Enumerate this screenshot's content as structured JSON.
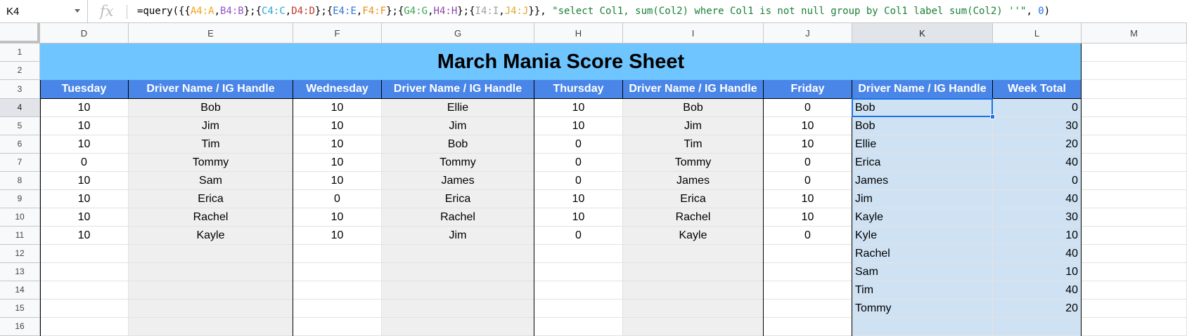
{
  "name_box": "K4",
  "fx_symbol": "fx",
  "formula": {
    "p0": "=query({{",
    "r1": "A4:A",
    "c1": ",",
    "r2": "B4:B",
    "c2": "};{",
    "r3": "C4:C",
    "c3": ",",
    "r4": "D4:D",
    "c4": "};{",
    "r5": "E4:E",
    "c5": ",",
    "r6": "F4:F",
    "c6": "};{",
    "r7": "G4:G",
    "c7": ",",
    "r8": "H4:H",
    "c8": "};{",
    "r9": "I4:I",
    "c9": ",",
    "r10": "J4:J",
    "c10": "}}, ",
    "str": "\"select Col1, sum(Col2) where Col1 is not null group by Col1 label sum(Col2) ''\"",
    "c11": ", ",
    "num": "0",
    "end": ")"
  },
  "columns": [
    "D",
    "E",
    "F",
    "G",
    "H",
    "I",
    "J",
    "K",
    "L",
    "M"
  ],
  "rows": [
    "1",
    "2",
    "3",
    "4",
    "5",
    "6",
    "7",
    "8",
    "9",
    "10",
    "11",
    "12",
    "13",
    "14",
    "15",
    "16"
  ],
  "sheet": {
    "title": "March Mania Score Sheet",
    "headers": [
      "Tuesday",
      "Driver Name / IG Handle",
      "Wednesday",
      "Driver Name / IG Handle",
      "Thursday",
      "Driver Name / IG Handle",
      "Friday",
      "Driver Name / IG Handle",
      "Week Total"
    ],
    "data": [
      [
        "10",
        "Bob",
        "10",
        "Ellie",
        "10",
        "Bob",
        "0",
        "Bob",
        "0"
      ],
      [
        "10",
        "Jim",
        "10",
        "Jim",
        "10",
        "Jim",
        "10",
        "Bob",
        "30"
      ],
      [
        "10",
        "Tim",
        "10",
        "Bob",
        "0",
        "Tim",
        "10",
        "Ellie",
        "20"
      ],
      [
        "0",
        "Tommy",
        "10",
        "Tommy",
        "0",
        "Tommy",
        "0",
        "Erica",
        "40"
      ],
      [
        "10",
        "Sam",
        "10",
        "James",
        "0",
        "James",
        "0",
        "James",
        "0"
      ],
      [
        "10",
        "Erica",
        "0",
        "Erica",
        "10",
        "Erica",
        "10",
        "Jim",
        "40"
      ],
      [
        "10",
        "Rachel",
        "10",
        "Rachel",
        "10",
        "Rachel",
        "10",
        "Kayle",
        "30"
      ],
      [
        "10",
        "Kayle",
        "10",
        "Jim",
        "0",
        "Kayle",
        "0",
        "Kyle",
        "10"
      ],
      [
        "",
        "",
        "",
        "",
        "",
        "",
        "",
        "Rachel",
        "40"
      ],
      [
        "",
        "",
        "",
        "",
        "",
        "",
        "",
        "Sam",
        "10"
      ],
      [
        "",
        "",
        "",
        "",
        "",
        "",
        "",
        "Tim",
        "40"
      ],
      [
        "",
        "",
        "",
        "",
        "",
        "",
        "",
        "Tommy",
        "20"
      ],
      [
        "",
        "",
        "",
        "",
        "",
        "",
        "",
        "",
        ""
      ]
    ]
  },
  "colors": {
    "title_band": "#6fc5ff",
    "header_fill": "#4a86e8",
    "gray_fill": "#efefef",
    "result_fill": "#cfe2f3",
    "selection": "#1a73e8"
  }
}
